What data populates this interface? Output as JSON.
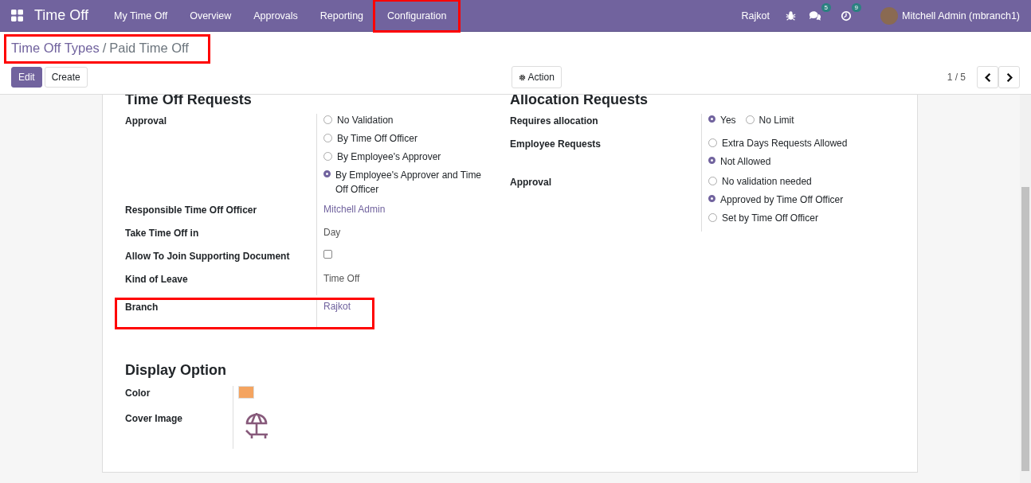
{
  "navbar": {
    "app_name": "Time Off",
    "menu": [
      {
        "label": "My Time Off",
        "highlighted": false
      },
      {
        "label": "Overview",
        "highlighted": false
      },
      {
        "label": "Approvals",
        "highlighted": false
      },
      {
        "label": "Reporting",
        "highlighted": false
      },
      {
        "label": "Configuration",
        "highlighted": true
      }
    ],
    "company": "Rajkot",
    "messages_count": "5",
    "activities_count": "9",
    "user": "Mitchell Admin (mbranch1)"
  },
  "breadcrumb": {
    "parent": "Time Off Types",
    "separator": "/",
    "current": "Paid Time Off",
    "highlighted": true
  },
  "buttons": {
    "edit": "Edit",
    "create": "Create",
    "action": "Action"
  },
  "pager": "1 / 5",
  "time_off_requests": {
    "title": "Time Off Requests",
    "fields": [
      {
        "label": "Approval",
        "kind": "radio",
        "highlighted": false,
        "options": [
          {
            "label": "No Validation",
            "selected": false
          },
          {
            "label": "By Time Off Officer",
            "selected": false
          },
          {
            "label": "By Employee's Approver",
            "selected": false
          },
          {
            "label": "By Employee's Approver and Time Off Officer",
            "selected": true
          }
        ]
      },
      {
        "label": "Responsible Time Off Officer",
        "kind": "link",
        "highlighted": false,
        "value": "Mitchell Admin"
      },
      {
        "label": "Take Time Off in",
        "kind": "text",
        "highlighted": false,
        "value": "Day"
      },
      {
        "label": "Allow To Join Supporting Document",
        "kind": "checkbox",
        "highlighted": false,
        "checked": false
      },
      {
        "label": "Kind of Leave",
        "kind": "text",
        "highlighted": false,
        "value": "Time Off"
      },
      {
        "label": "Branch",
        "kind": "link",
        "highlighted": true,
        "value": "Rajkot"
      }
    ]
  },
  "allocation_requests": {
    "title": "Allocation Requests",
    "fields": [
      {
        "label": "Requires allocation",
        "kind": "radio-inline",
        "options": [
          {
            "label": "Yes",
            "selected": true
          },
          {
            "label": "No Limit",
            "selected": false
          }
        ]
      },
      {
        "label": "Employee Requests",
        "kind": "radio",
        "options": [
          {
            "label": "Extra Days Requests Allowed",
            "selected": false
          },
          {
            "label": "Not Allowed",
            "selected": true
          }
        ]
      },
      {
        "label": "Approval",
        "kind": "radio",
        "options": [
          {
            "label": "No validation needed",
            "selected": false
          },
          {
            "label": "Approved by Time Off Officer",
            "selected": true
          },
          {
            "label": "Set by Time Off Officer",
            "selected": false
          }
        ]
      }
    ]
  },
  "display_option": {
    "title": "Display Option",
    "color_label": "Color",
    "color": "#f4a460",
    "cover_label": "Cover Image"
  }
}
